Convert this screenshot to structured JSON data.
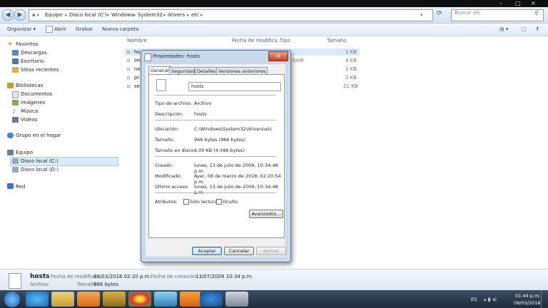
{
  "window": {
    "controls": [
      "–",
      "□",
      "×"
    ]
  },
  "address": {
    "parts": [
      "Equipo",
      "Disco local (C:)",
      "Windows",
      "System32",
      "drivers",
      "etc"
    ],
    "search_placeholder": "Buscar etc"
  },
  "toolbar": {
    "organize": "Organizar",
    "open": "Abrir",
    "record": "Grabar",
    "new_folder": "Nueva carpeta"
  },
  "nav": {
    "favorites": "Favoritos",
    "downloads": "Descargas",
    "desktop": "Escritorio",
    "recent": "Sitios recientes",
    "libraries": "Bibliotecas",
    "documents": "Documentos",
    "images": "Imágenes",
    "music": "Música",
    "videos": "Vídeos",
    "homegroup": "Grupo en el hogar",
    "computer": "Equipo",
    "disk_c": "Disco local (C:)",
    "disk_d": "Disco local (D:)",
    "network": "Red"
  },
  "filelist": {
    "columns": [
      "Nombre",
      "Fecha de modifica...",
      "Tipo",
      "Tamaño"
    ],
    "rows": [
      {
        "name": "ho",
        "type": "",
        "size": "1 KB"
      },
      {
        "name": "lm",
        "type": "SAM",
        "size": "4 KB"
      },
      {
        "name": "ne",
        "type": "",
        "size": "1 KB"
      },
      {
        "name": "pr",
        "type": "",
        "size": "2 KB"
      },
      {
        "name": "se",
        "type": "",
        "size": "21 KB"
      }
    ]
  },
  "dialog": {
    "title": "Propiedades: hosts",
    "close": "×",
    "tabs": [
      "General",
      "Seguridad",
      "Detalles",
      "Versiones anteriores"
    ],
    "filename": "hosts",
    "fields": {
      "type_label": "Tipo de archivo:",
      "type_value": "Archivo",
      "desc_label": "Descripción:",
      "desc_value": "hosts",
      "loc_label": "Ubicación:",
      "loc_value": "C:\\Windows\\System32\\drivers\\etc",
      "size_label": "Tamaño:",
      "size_value": "966 bytes (966 bytes)",
      "disk_label": "Tamaño en disco:",
      "disk_value": "4,00 KB (4.096 bytes)",
      "created_label": "Creado:",
      "created_value": "lunes, 13 de julio de 2009, 10:34:48 p.m.",
      "modified_label": "Modificado:",
      "modified_value": "Ayer, 08 de marzo de 2018, 02:20:54 p.m.",
      "access_label": "Último acceso:",
      "access_value": "lunes, 13 de julio de 2009, 10:34:48 p.m.",
      "attr_label": "Atributos:",
      "readonly": "Sólo lectura",
      "hidden": "Oculto",
      "advanced": "Avanzados..."
    },
    "buttons": {
      "ok": "Aceptar",
      "cancel": "Cancelar",
      "apply": "Aplicar"
    }
  },
  "details": {
    "name": "hosts",
    "kind": "Archivo",
    "mod_label": "Fecha de modifica...",
    "mod_value": "08/03/2018 02:20 p.m.",
    "size_label": "Tamaño:",
    "size_value": "966 bytes",
    "created_label": "Fecha de creación:",
    "created_value": "13/07/2009 10:34 p.m."
  },
  "taskbar": {
    "lang": "ES",
    "time": "01:44 p.m.",
    "date": "09/03/2018"
  },
  "colors": {
    "accent": "#2b5797",
    "close_red": "#c44126"
  }
}
